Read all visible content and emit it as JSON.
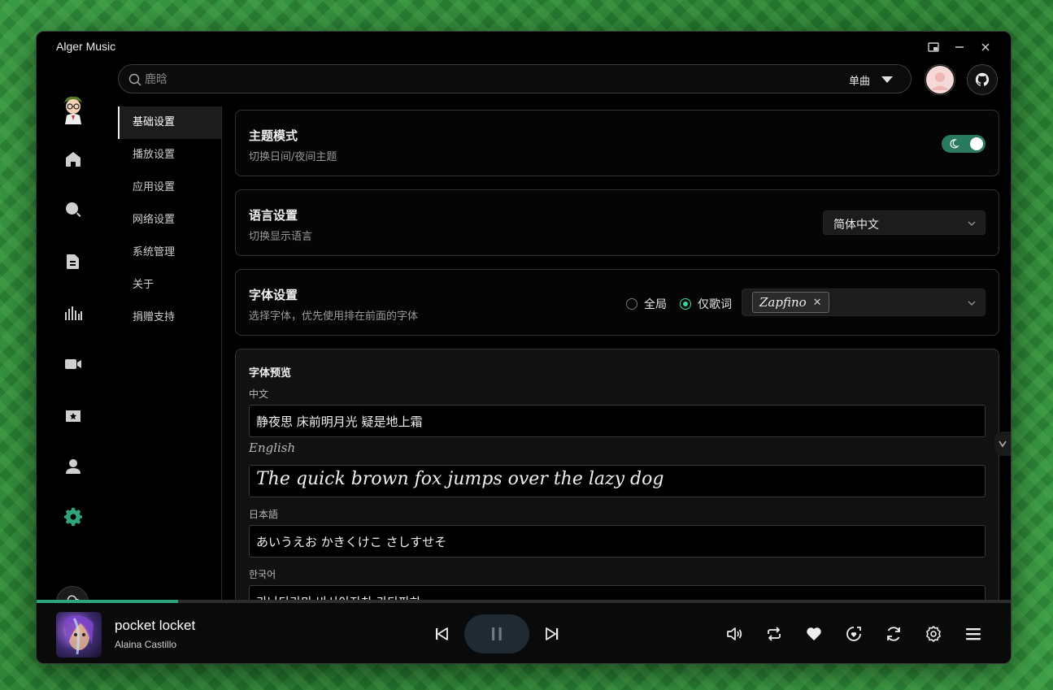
{
  "window": {
    "title": "Alger Music"
  },
  "search": {
    "placeholder": "鹿晗",
    "type_label": "单曲"
  },
  "settings_nav": {
    "items": [
      {
        "label": "基础设置",
        "active": true
      },
      {
        "label": "播放设置",
        "active": false
      },
      {
        "label": "应用设置",
        "active": false
      },
      {
        "label": "网络设置",
        "active": false
      },
      {
        "label": "系统管理",
        "active": false
      },
      {
        "label": "关于",
        "active": false
      },
      {
        "label": "捐赠支持",
        "active": false
      }
    ]
  },
  "theme": {
    "title": "主题模式",
    "desc": "切换日间/夜间主题",
    "dark_mode": true
  },
  "language": {
    "title": "语言设置",
    "desc": "切换显示语言",
    "selected": "简体中文"
  },
  "font": {
    "title": "字体设置",
    "desc": "选择字体，优先使用排在前面的字体",
    "scope_global": "全局",
    "scope_lyrics": "仅歌词",
    "selected_scope": "lyrics",
    "selected_font": "Zapfino"
  },
  "preview": {
    "title": "字体预览",
    "items": [
      {
        "label": "中文",
        "text": "静夜思 床前明月光 疑是地上霜"
      },
      {
        "label": "English",
        "text": "The quick brown fox jumps over the lazy dog"
      },
      {
        "label": "日本語",
        "text": "あいうえお かきくけこ さしすせそ"
      },
      {
        "label": "한국어",
        "text": "가나다라마 바사아자차 카타파하"
      }
    ]
  },
  "player": {
    "song_title": "pocket locket",
    "artist": "Alaina Castillo",
    "progress": 0.145
  },
  "colors": {
    "accent": "#2fa37a",
    "window_bg": "#000000"
  }
}
